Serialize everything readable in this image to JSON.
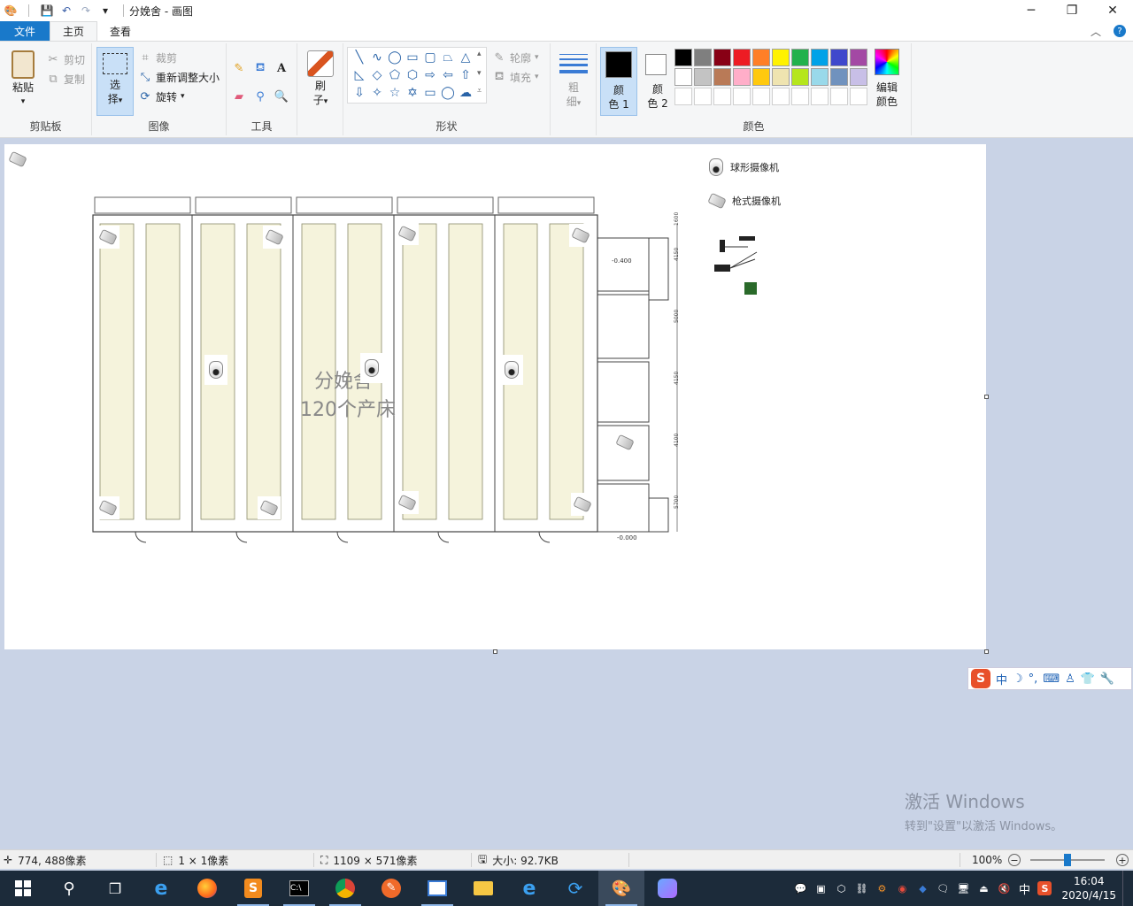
{
  "window": {
    "title": "分娩舍 - 画图"
  },
  "menu_tabs": [
    {
      "label": "文件"
    },
    {
      "label": "主页"
    },
    {
      "label": "查看"
    }
  ],
  "ribbon": {
    "clipboard": {
      "group_label": "剪贴板",
      "paste": "粘贴",
      "cut": "剪切",
      "copy": "复制"
    },
    "image": {
      "group_label": "图像",
      "select": "选",
      "select2": "择",
      "crop": "裁剪",
      "resize": "重新调整大小",
      "rotate": "旋转"
    },
    "tools": {
      "group_label": "工具"
    },
    "brushes": {
      "label1": "刷",
      "label2": "子"
    },
    "shapes": {
      "group_label": "形状",
      "outline": "轮廓",
      "fill": "填充"
    },
    "size": {
      "label1": "粗",
      "label2": "细"
    },
    "colors": {
      "group_label": "颜色",
      "color1_a": "颜",
      "color1_b": "色 1",
      "color2_a": "颜",
      "color2_b": "色 2",
      "edit_a": "编辑",
      "edit_b": "颜色",
      "color1_value": "#000000",
      "color2_value": "#ffffff",
      "palette_row1": [
        "#000000",
        "#7f7f7f",
        "#880015",
        "#ed1c24",
        "#ff7f27",
        "#fff200",
        "#22b14c",
        "#00a2e8",
        "#3f48cc",
        "#a349a4"
      ],
      "palette_row2": [
        "#ffffff",
        "#c3c3c3",
        "#b97a57",
        "#ffaec9",
        "#ffc90e",
        "#efe4b0",
        "#b5e61d",
        "#99d9ea",
        "#7092be",
        "#c8bfe7"
      ]
    }
  },
  "canvas_content": {
    "legend_dome": "球形摄像机",
    "legend_gun": "枪式摄像机",
    "center_line1": "分娩舍",
    "center_line2": "120个产床",
    "room_label1": "-0.400",
    "room_label2": "-0.000",
    "dimensions": [
      "1600",
      "4150",
      "5000",
      "4150",
      "4100",
      "5700"
    ]
  },
  "ime_bar": {
    "lang": "中"
  },
  "watermark": {
    "line1": "激活 Windows",
    "line2": "转到\"设置\"以激活 Windows。"
  },
  "statusbar": {
    "cursor": "774, 488像素",
    "selection": "1 × 1像素",
    "image_size": "1109 × 571像素",
    "file_size": "大小: 92.7KB",
    "zoom": "100%",
    "zoom_fraction": 0.5
  },
  "taskbar": {
    "time": "16:04",
    "date": "2020/4/15",
    "ime": "中"
  }
}
